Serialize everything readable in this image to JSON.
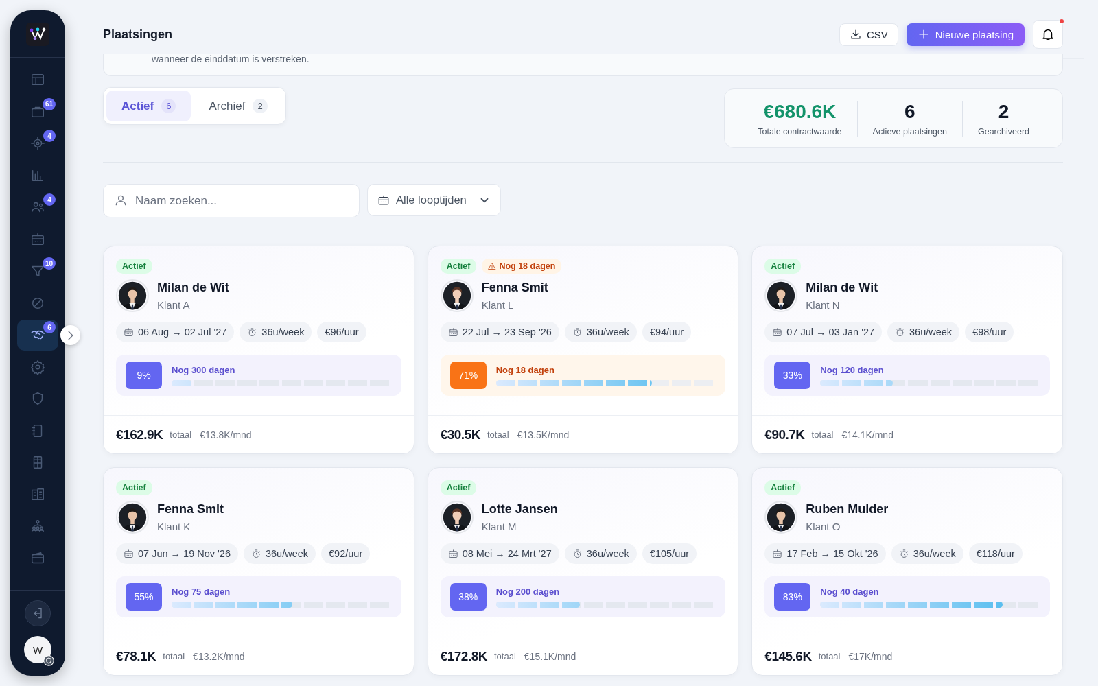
{
  "sidebar": {
    "items": [
      {
        "selected": false
      },
      {
        "badge": "61",
        "selected": false
      },
      {
        "badge": "4",
        "selected": false
      },
      {
        "selected": false
      },
      {
        "badge": "4",
        "selected": false
      },
      {
        "selected": false
      },
      {
        "badge": "10",
        "selected": false
      },
      {
        "selected": false
      },
      {
        "badge": "6",
        "selected": true
      },
      {
        "selected": false
      },
      {
        "selected": false
      },
      {
        "selected": false
      },
      {
        "selected": false
      },
      {
        "selected": false
      },
      {
        "selected": false
      },
      {
        "selected": false
      }
    ],
    "user_initial": "W"
  },
  "header": {
    "title": "Plaatsingen",
    "csv_button": "CSV",
    "new_button": "Nieuwe plaatsing",
    "notifications_unread": true
  },
  "banner": {
    "text": "wanneer de einddatum is verstreken."
  },
  "tabs": [
    {
      "label": "Actief",
      "count": "6",
      "selected": true
    },
    {
      "label": "Archief",
      "count": "2",
      "selected": false
    }
  ],
  "stats": [
    {
      "value": "€680.6K",
      "label": "Totale contractwaarde",
      "color": "#13936a"
    },
    {
      "value": "6",
      "label": "Actieve plaatsingen",
      "color": "#111827"
    },
    {
      "value": "2",
      "label": "Gearchiveerd",
      "color": "#111827"
    }
  ],
  "search": {
    "placeholder": "Naam zoeken..."
  },
  "duration_filter": {
    "value": "Alle looptijden"
  },
  "placements": [
    {
      "status": "Actief",
      "name": "Milan de Wit",
      "client": "Klant A",
      "period": "06 Aug → 02 Jul '27",
      "hours": "36u/week",
      "rate": "€96/uur",
      "percent": "9%",
      "level": 0.09,
      "remaining": "Nog 300 dagen",
      "urgent": false,
      "total": "€162.9K",
      "total_label": "totaal",
      "monthly": "€13.8K/mnd"
    },
    {
      "status": "Actief",
      "warning": "Nog 18 dagen",
      "name": "Fenna Smit",
      "client": "Klant L",
      "period": "22 Jul → 23 Sep '26",
      "hours": "36u/week",
      "rate": "€94/uur",
      "percent": "71%",
      "level": 0.71,
      "remaining": "Nog 18 dagen",
      "urgent": true,
      "total": "€30.5K",
      "total_label": "totaal",
      "monthly": "€13.5K/mnd"
    },
    {
      "status": "Actief",
      "name": "Milan de Wit",
      "client": "Klant N",
      "period": "07 Jul → 03 Jan '27",
      "hours": "36u/week",
      "rate": "€98/uur",
      "percent": "33%",
      "level": 0.33,
      "remaining": "Nog 120 dagen",
      "urgent": false,
      "total": "€90.7K",
      "total_label": "totaal",
      "monthly": "€14.1K/mnd"
    },
    {
      "status": "Actief",
      "name": "Fenna Smit",
      "client": "Klant K",
      "period": "07 Jun → 19 Nov '26",
      "hours": "36u/week",
      "rate": "€92/uur",
      "percent": "55%",
      "level": 0.55,
      "remaining": "Nog 75 dagen",
      "urgent": false,
      "total": "€78.1K",
      "total_label": "totaal",
      "monthly": "€13.2K/mnd"
    },
    {
      "status": "Actief",
      "name": "Lotte Jansen",
      "client": "Klant M",
      "period": "08 Mei → 24 Mrt '27",
      "hours": "36u/week",
      "rate": "€105/uur",
      "percent": "38%",
      "level": 0.38,
      "remaining": "Nog 200 dagen",
      "urgent": false,
      "total": "€172.8K",
      "total_label": "totaal",
      "monthly": "€15.1K/mnd"
    },
    {
      "status": "Actief",
      "name": "Ruben Mulder",
      "client": "Klant O",
      "period": "17 Feb → 15 Okt '26",
      "hours": "36u/week",
      "rate": "€118/uur",
      "percent": "83%",
      "level": 0.83,
      "remaining": "Nog 40 dagen",
      "urgent": false,
      "total": "€145.6K",
      "total_label": "totaal",
      "monthly": "€17K/mnd"
    }
  ]
}
